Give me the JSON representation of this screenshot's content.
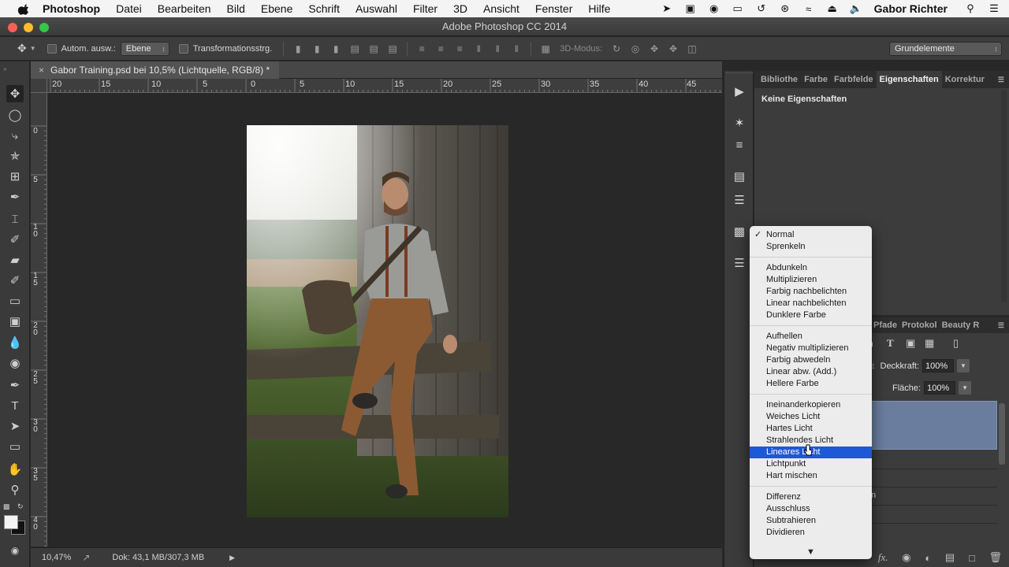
{
  "menubar": {
    "app_name": "Photoshop",
    "items": [
      "Datei",
      "Bearbeiten",
      "Bild",
      "Ebene",
      "Schrift",
      "Auswahl",
      "Filter",
      "3D",
      "Ansicht",
      "Fenster",
      "Hilfe"
    ],
    "user": "Gabor Richter"
  },
  "window": {
    "title": "Adobe Photoshop CC 2014"
  },
  "options_bar": {
    "auto_select_label": "Autom. ausw.:",
    "auto_select_value": "Ebene",
    "transform_label": "Transformationsstrg.",
    "mode_3d_label": "3D-Modus:",
    "workspace_value": "Grundelemente"
  },
  "document": {
    "tab_title": "Gabor Training.psd bei 10,5% (Lichtquelle, RGB/8) *",
    "ruler_h_labels": [
      "20",
      "15",
      "10",
      "5",
      "0",
      "5",
      "10",
      "15",
      "20",
      "25",
      "30",
      "35",
      "40",
      "45"
    ],
    "ruler_v_labels": [
      "0",
      "5",
      "1 0",
      "1 5",
      "2 0",
      "2 5",
      "3 0",
      "3 5",
      "4 0"
    ]
  },
  "status": {
    "zoom": "10,47%",
    "doc_size": "Dok: 43,1 MB/307,3 MB"
  },
  "properties_panel": {
    "tabs": [
      "Bibliothe",
      "Farbe",
      "Farbfelde",
      "Eigenschaften",
      "Korrektur"
    ],
    "active_tab": "Eigenschaften",
    "empty_text": "Keine Eigenschaften"
  },
  "layers_panel": {
    "tabs": [
      "Pfade",
      "Protokol",
      "Beauty R"
    ],
    "opacity_label": "Deckkraft:",
    "opacity_value": "100%",
    "fill_label": "Fläche:",
    "fill_value": "100%",
    "partial_layer_text": "n"
  },
  "blend_menu": {
    "groups": [
      [
        "Normal",
        "Sprenkeln"
      ],
      [
        "Abdunkeln",
        "Multiplizieren",
        "Farbig nachbelichten",
        "Linear nachbelichten",
        "Dunklere Farbe"
      ],
      [
        "Aufhellen",
        "Negativ multiplizieren",
        "Farbig abwedeln",
        "Linear abw. (Add.)",
        "Hellere Farbe"
      ],
      [
        "Ineinanderkopieren",
        "Weiches Licht",
        "Hartes Licht",
        "Strahlendes Licht",
        "Lineares Licht",
        "Lichtpunkt",
        "Hart mischen"
      ],
      [
        "Differenz",
        "Ausschluss",
        "Subtrahieren",
        "Dividieren"
      ]
    ],
    "checked": "Normal",
    "highlighted": "Lineares Licht",
    "highlight_color": "#1d58d6"
  }
}
